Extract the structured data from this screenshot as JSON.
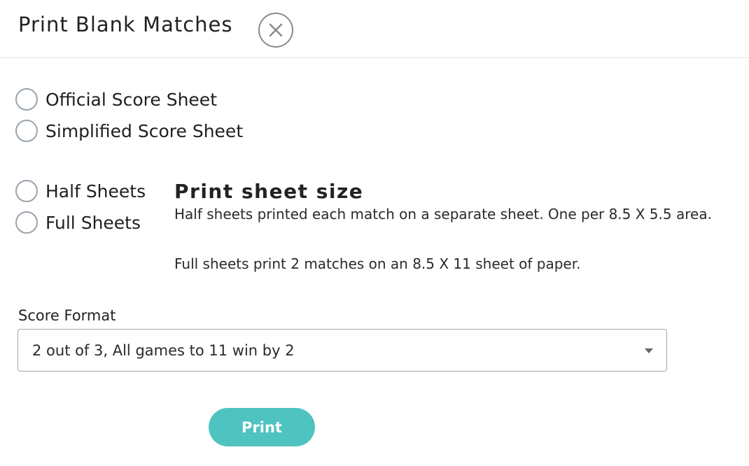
{
  "header": {
    "title": "Print Blank Matches",
    "close_icon": "close-circle-icon"
  },
  "sheet_type": {
    "options": [
      {
        "label": "Official Score Sheet",
        "selected": false
      },
      {
        "label": "Simplified Score Sheet",
        "selected": false
      }
    ]
  },
  "sheet_size": {
    "options": [
      {
        "label": "Half Sheets",
        "selected": false
      },
      {
        "label": "Full Sheets",
        "selected": false
      }
    ],
    "heading": "Print sheet size",
    "half_description": "Half sheets printed each match on a separate sheet. One per 8.5 X 5.5 area.",
    "full_description": "Full sheets print 2 matches on an 8.5 X 11 sheet of paper."
  },
  "score_format": {
    "label": "Score Format",
    "selected_value": "2 out of 3, All games to 11 win by 2"
  },
  "actions": {
    "print_label": "Print"
  },
  "colors": {
    "accent": "#4fc3c0",
    "radio_border": "#9aa3ad"
  }
}
